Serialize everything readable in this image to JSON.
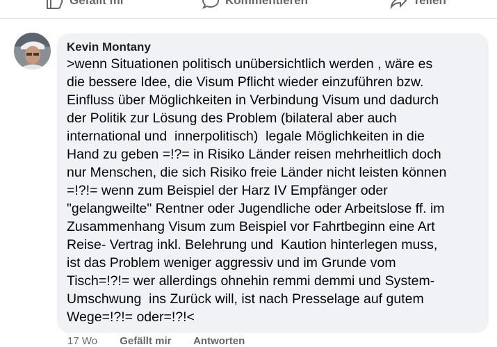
{
  "post_actions": {
    "like_label": "Gefällt mi",
    "comment_label": "Kommentieren",
    "share_label": "Teilen"
  },
  "comment": {
    "author": "Kevin Montany",
    "lines": [
      ">wenn Situationen politisch unübersichtlich werden , wäre es",
      "die bessere Idee, die Visum Pflicht wieder einzuführen bzw.",
      "Einfluss über Möglichkeiten in Verbindung Visum und dadurch",
      "der Politik zur Lösung des Problem (bilateral aber auch",
      "international und  innerpolitisch)  legale Möglichkeiten in die",
      "Hand zu geben =!?= in Risiko Länder reisen mehrheitlich doch",
      "nur Menschen, die sich Risiko freie Länder nicht leisten können",
      "=!?!= wenn zum Beispiel der Harz IV Empfänger oder",
      "\"gelangweilte\" Rentner oder Jugendliche oder Arbeitslose ff. im",
      "Zusammenhang Visum zum Beispiel vor Fahrtbeginn eine Art",
      "Reise- Vertrag inkl. Belehrung und  Kaution hinterlegen muss,",
      "ist das Problem weniger aggressiv und im Grunde vom",
      "Tisch=!?!= wer allerdings ohnehin remmi demmi und System-",
      "Umschwung  ins Zurück will, ist nach Presselage auf gutem",
      "Wege=!?!= oder=!?!<"
    ],
    "footer": {
      "time": "17 Wo",
      "like_label": "Gefällt mir",
      "reply_label": "Antworten"
    }
  }
}
